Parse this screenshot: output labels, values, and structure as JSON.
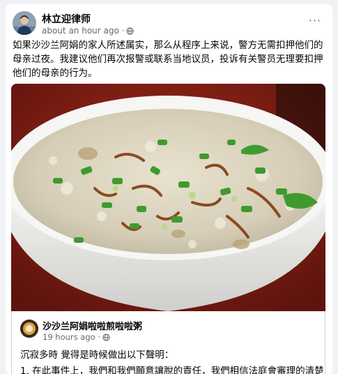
{
  "post": {
    "author": "林立迎律师",
    "timestamp": "about an hour ago ·",
    "privacy_icon": "globe-icon",
    "more_icon": "more-options-icon",
    "more_label": "···",
    "body": "如果沙沙兰阿娟的家人所述属实，那么从程序上来说，警方无需扣押他们的母亲过夜。我建议他们再次报警或联系当地议员，投诉有关警员无理要扣押他们的母亲的行为。"
  },
  "shared_post": {
    "author": "沙沙兰阿娟啦啦煎啦啦粥",
    "timestamp": "19 hours ago ·",
    "privacy_icon": "globe-icon",
    "text_line1": "沉寂多時 覺得是時候做出以下聲明：",
    "text_line2": "1. 在此事件上，我們和我們願意讓脫的責任，我們相信法庭會審理的清楚"
  },
  "colors": {
    "background": "#f0f2f5",
    "card": "#ffffff",
    "secondary_text": "#65676b"
  }
}
